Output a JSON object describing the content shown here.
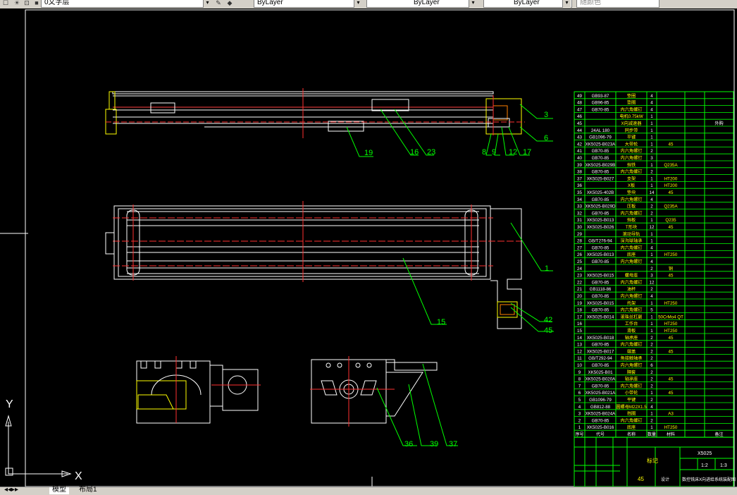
{
  "toolbar": {
    "layer_name": "0文字层",
    "color_select": "ByLayer",
    "linetype_select": "ByLayer",
    "lineweight_select": "ByLayer",
    "plotstyle_select": "随颜色"
  },
  "ucs": {
    "x_label": "X",
    "y_label": "Y"
  },
  "balloons": {
    "b3": "3",
    "b6": "6",
    "b8": "8",
    "b9": "9",
    "b12": "12",
    "b17": "17",
    "b16": "16",
    "b23": "23",
    "b19": "19",
    "b1": "1",
    "b15": "15",
    "b42": "42",
    "b45": "45",
    "b36": "36",
    "b39": "39",
    "b37": "37"
  },
  "bom_rows": [
    {
      "no": "49",
      "code": "GB93-87",
      "name": "垫圈",
      "qty": "4",
      "mat": "",
      "note": ""
    },
    {
      "no": "48",
      "code": "GB96-85",
      "name": "垫圈",
      "qty": "4",
      "mat": "",
      "note": ""
    },
    {
      "no": "47",
      "code": "GB70-85",
      "name": "内六角螺钉",
      "qty": "4",
      "mat": "",
      "note": ""
    },
    {
      "no": "46",
      "code": "",
      "name": "电机0.75kW",
      "qty": "1",
      "mat": "",
      "note": ""
    },
    {
      "no": "45",
      "code": "",
      "name": "X向减速器",
      "qty": "1",
      "mat": "",
      "note": "外购"
    },
    {
      "no": "44",
      "code": "24AL 180",
      "name": "同步带",
      "qty": "1",
      "mat": "",
      "note": ""
    },
    {
      "no": "43",
      "code": "GB1096-79",
      "name": "平键",
      "qty": "1",
      "mat": "",
      "note": ""
    },
    {
      "no": "42",
      "code": "XK5025-B023A",
      "name": "大带轮",
      "qty": "1",
      "mat": "45",
      "note": ""
    },
    {
      "no": "41",
      "code": "GB70-85",
      "name": "内六角螺钉",
      "qty": "2",
      "mat": "",
      "note": ""
    },
    {
      "no": "40",
      "code": "GB70-85",
      "name": "内六角螺钉",
      "qty": "3",
      "mat": "",
      "note": ""
    },
    {
      "no": "39",
      "code": "XK5025-B029B",
      "name": "挡铁",
      "qty": "1",
      "mat": "Q235A",
      "note": ""
    },
    {
      "no": "38",
      "code": "GB70-85",
      "name": "内六角螺钉",
      "qty": "2",
      "mat": "",
      "note": ""
    },
    {
      "no": "37",
      "code": "XK5025-B027",
      "name": "支架",
      "qty": "1",
      "mat": "HT200",
      "note": ""
    },
    {
      "no": "36",
      "code": "",
      "name": "X板",
      "qty": "1",
      "mat": "HT200",
      "note": ""
    },
    {
      "no": "35",
      "code": "XK5025-402B",
      "name": "垫块",
      "qty": "14",
      "mat": "45",
      "note": ""
    },
    {
      "no": "34",
      "code": "GB70-85",
      "name": "内六角螺钉",
      "qty": "4",
      "mat": "",
      "note": ""
    },
    {
      "no": "33",
      "code": "XK5025-B029D",
      "name": "压板",
      "qty": "2",
      "mat": "Q235A",
      "note": ""
    },
    {
      "no": "32",
      "code": "GB70-85",
      "name": "内六角螺钉",
      "qty": "2",
      "mat": "",
      "note": ""
    },
    {
      "no": "31",
      "code": "XK5025-B013",
      "name": "挡板",
      "qty": "1",
      "mat": "Q235",
      "note": ""
    },
    {
      "no": "30",
      "code": "XK5025-B026",
      "name": "T形块",
      "qty": "12",
      "mat": "45",
      "note": ""
    },
    {
      "no": "29",
      "code": "",
      "name": "滚动导轨",
      "qty": "1",
      "mat": "",
      "note": ""
    },
    {
      "no": "28",
      "code": "GB/T276-94",
      "name": "深沟球轴承",
      "qty": "1",
      "mat": "",
      "note": ""
    },
    {
      "no": "27",
      "code": "GB70-85",
      "name": "内六角螺钉",
      "qty": "4",
      "mat": "",
      "note": ""
    },
    {
      "no": "26",
      "code": "XK5025-B013",
      "name": "底座",
      "qty": "1",
      "mat": "HT250",
      "note": ""
    },
    {
      "no": "25",
      "code": "GB70-85",
      "name": "内六角螺钉",
      "qty": "4",
      "mat": "",
      "note": ""
    },
    {
      "no": "24",
      "code": "",
      "name": "",
      "qty": "2",
      "mat": "铜",
      "note": ""
    },
    {
      "no": "23",
      "code": "XK5025-B015",
      "name": "螺母座",
      "qty": "3",
      "mat": "45",
      "note": ""
    },
    {
      "no": "22",
      "code": "GB70-85",
      "name": "内六角螺钉",
      "qty": "12",
      "mat": "",
      "note": ""
    },
    {
      "no": "21",
      "code": "GB1118-86",
      "name": "油杯",
      "qty": "2",
      "mat": "",
      "note": ""
    },
    {
      "no": "20",
      "code": "GB70-85",
      "name": "内六角螺钉",
      "qty": "4",
      "mat": "",
      "note": ""
    },
    {
      "no": "19",
      "code": "XK5025-B015",
      "name": "托架",
      "qty": "1",
      "mat": "HT250",
      "note": ""
    },
    {
      "no": "18",
      "code": "GB70-85",
      "name": "内六角螺钉",
      "qty": "5",
      "mat": "",
      "note": ""
    },
    {
      "no": "17",
      "code": "XK5025-B014",
      "name": "滚珠丝杠副",
      "qty": "1",
      "mat": "50CrMo4 QT",
      "note": ""
    },
    {
      "no": "16",
      "code": "",
      "name": "工作台",
      "qty": "1",
      "mat": "HT250",
      "note": ""
    },
    {
      "no": "15",
      "code": "",
      "name": "滑板",
      "qty": "1",
      "mat": "HT250",
      "note": ""
    },
    {
      "no": "14",
      "code": "XK5025-B018",
      "name": "轴承座",
      "qty": "2",
      "mat": "45",
      "note": ""
    },
    {
      "no": "13",
      "code": "GB70-85",
      "name": "内六角螺钉",
      "qty": "2",
      "mat": "",
      "note": ""
    },
    {
      "no": "12",
      "code": "XK5025-B017",
      "name": "端盖",
      "qty": "2",
      "mat": "45",
      "note": ""
    },
    {
      "no": "11",
      "code": "GB/T292-94",
      "name": "角接触轴承",
      "qty": "2",
      "mat": "",
      "note": ""
    },
    {
      "no": "10",
      "code": "GB70-85",
      "name": "内六角螺钉",
      "qty": "6",
      "mat": "",
      "note": ""
    },
    {
      "no": "9",
      "code": "XK5025-B01",
      "name": "隔套",
      "qty": "2",
      "mat": "",
      "note": ""
    },
    {
      "no": "8",
      "code": "XK5025-B020A",
      "name": "轴承座",
      "qty": "2",
      "mat": "45",
      "note": ""
    },
    {
      "no": "7",
      "code": "GB70-85",
      "name": "内六角螺钉",
      "qty": "2",
      "mat": "",
      "note": ""
    },
    {
      "no": "6",
      "code": "XK5025-B021A",
      "name": "小带轮",
      "qty": "1",
      "mat": "45",
      "note": ""
    },
    {
      "no": "5",
      "code": "GB1096-79",
      "name": "平键",
      "qty": "2",
      "mat": "",
      "note": ""
    },
    {
      "no": "4",
      "code": "GB812-88",
      "name": "圆螺母M22X1.5",
      "qty": "4",
      "mat": "",
      "note": ""
    },
    {
      "no": "3",
      "code": "XK5025-B024A",
      "name": "挡圈",
      "qty": "1",
      "mat": "A3",
      "note": ""
    },
    {
      "no": "2",
      "code": "GB70-85",
      "name": "内六角螺钉",
      "qty": "2",
      "mat": "",
      "note": ""
    },
    {
      "no": "1",
      "code": "XK5025-B016",
      "name": "底座",
      "qty": "1",
      "mat": "HT250",
      "note": ""
    }
  ],
  "bom_header": {
    "no": "序号",
    "code": "代号",
    "name": "名称",
    "qty": "数量",
    "mat": "材料",
    "note": "备注"
  },
  "title_block": {
    "drawing_no": "X5025",
    "material": "45",
    "scale": "1:2",
    "sheet": "1:3",
    "title": "数控铣床X向进给系统装配图",
    "company": "标记",
    "designer": "设计"
  },
  "layout_tabs": {
    "model": "模型",
    "layout1": "布局1"
  }
}
